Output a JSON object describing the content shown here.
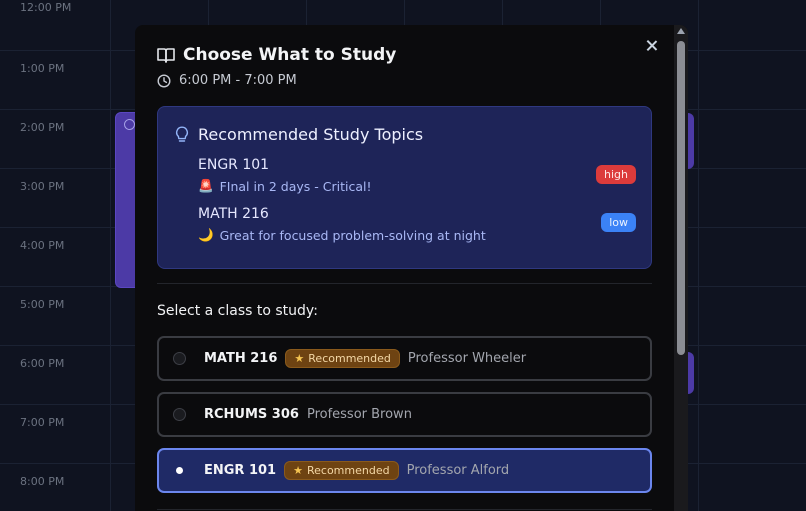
{
  "calendar": {
    "times": [
      "12:00 PM",
      "1:00 PM",
      "2:00 PM",
      "3:00 PM",
      "4:00 PM",
      "5:00 PM",
      "6:00 PM",
      "7:00 PM",
      "8:00 PM"
    ]
  },
  "modal": {
    "title": "Choose What to Study",
    "time_range": "6:00 PM - 7:00 PM",
    "recommended": {
      "heading": "Recommended Study Topics",
      "items": [
        {
          "course": "ENGR 101",
          "icon": "🚨",
          "reason": "FInal in 2 days - Critical!",
          "priority": "high"
        },
        {
          "course": "MATH 216",
          "icon": "🌙",
          "reason": "Great for focused problem-solving at night",
          "priority": "low"
        }
      ]
    },
    "select_label": "Select a class to study:",
    "classes": [
      {
        "code": "MATH 216",
        "badge": "Recommended",
        "professor": "Professor Wheeler",
        "selected": false
      },
      {
        "code": "RCHUMS 306",
        "badge": "",
        "professor": "Professor Brown",
        "selected": false
      },
      {
        "code": "ENGR 101",
        "badge": "Recommended",
        "professor": "Professor Alford",
        "selected": true
      }
    ]
  },
  "colors": {
    "recommend_box": "#1e2458",
    "priority_high": "#dc3b3b",
    "priority_low": "#3b82f6",
    "selected_row": "#1f2a66"
  }
}
